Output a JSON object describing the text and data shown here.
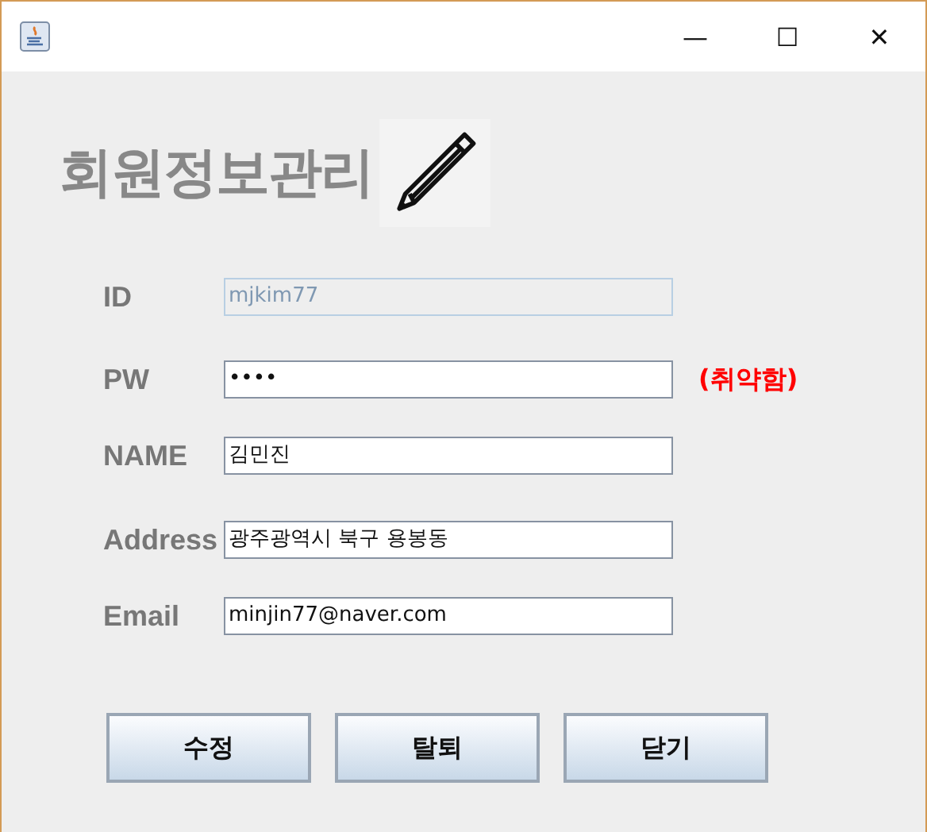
{
  "window": {
    "title_bar_buttons": [
      "—",
      "☐",
      "✕"
    ]
  },
  "heading": "회원정보관리",
  "fields": [
    {
      "label": "ID",
      "value": "mjkim77",
      "disabled": true
    },
    {
      "label": "PW",
      "value": "••••",
      "disabled": false,
      "warning": "(취약함)"
    },
    {
      "label": "NAME",
      "value": "김민진",
      "disabled": false
    },
    {
      "label": "Address",
      "value": "광주광역시 북구 용봉동",
      "disabled": false
    },
    {
      "label": "Email",
      "value": "minjin77@naver.com",
      "disabled": false
    }
  ],
  "buttons": [
    "수정",
    "탈퇴",
    "닫기"
  ]
}
